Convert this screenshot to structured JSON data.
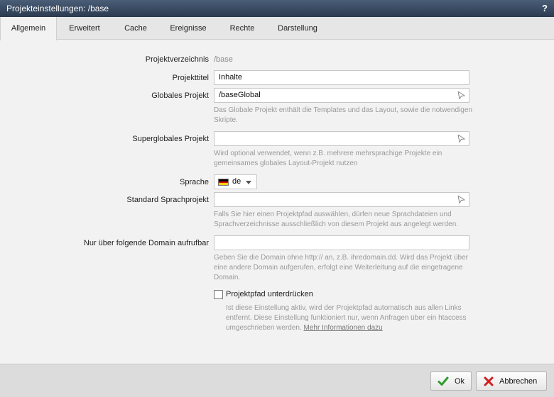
{
  "window": {
    "title": "Projekteinstellungen: /base",
    "help_label": "?"
  },
  "tabs": [
    {
      "label": "Allgemein",
      "active": true
    },
    {
      "label": "Erweitert",
      "active": false
    },
    {
      "label": "Cache",
      "active": false
    },
    {
      "label": "Ereignisse",
      "active": false
    },
    {
      "label": "Rechte",
      "active": false
    },
    {
      "label": "Darstellung",
      "active": false
    }
  ],
  "form": {
    "projektverzeichnis": {
      "label": "Projektverzeichnis",
      "value": "/base"
    },
    "projekttitel": {
      "label": "Projekttitel",
      "value": "Inhalte"
    },
    "globales_projekt": {
      "label": "Globales Projekt",
      "value": "/baseGlobal",
      "hint": "Das Globale Projekt enthält die Templates und das Layout, sowie die notwendigen Skripte."
    },
    "superglobales_projekt": {
      "label": "Superglobales Projekt",
      "value": "",
      "hint": "Wird optional verwendet, wenn z.B. mehrere mehrsprachige Projekte ein gemeinsames globales Layout-Projekt nutzen"
    },
    "sprache": {
      "label": "Sprache",
      "value": "de",
      "flag": "german-flag-icon"
    },
    "standard_sprachprojekt": {
      "label": "Standard Sprachprojekt",
      "value": "",
      "hint": "Falls Sie hier einen Projektpfad auswählen, dürfen neue Sprachdateien und Sprachverzeichnisse ausschließlich von diesem Projekt aus angelegt werden."
    },
    "domain": {
      "label": "Nur über folgende Domain aufrufbar",
      "value": "",
      "hint": "Geben Sie die Domain ohne http:// an, z.B. ihredomain.dd. Wird das Projekt über eine andere Domain aufgerufen, erfolgt eine Weiterleitung auf die eingetragene Domain."
    },
    "projektpfad_unterdruecken": {
      "label": "Projektpfad unterdrücken",
      "checked": false,
      "hint": "Ist diese Einstellung aktiv, wird der Projektpfad automatisch aus allen Links entfernt. Diese Einstellung funktioniert nur, wenn Anfragen über ein htaccess umgeschrieben werden.",
      "link": "Mehr Informationen dazu"
    }
  },
  "footer": {
    "ok_label": "Ok",
    "cancel_label": "Abbrechen"
  },
  "colors": {
    "ok_icon": "#2e9b2e",
    "cancel_icon": "#d01f1f",
    "titlebar": "#34465e"
  }
}
